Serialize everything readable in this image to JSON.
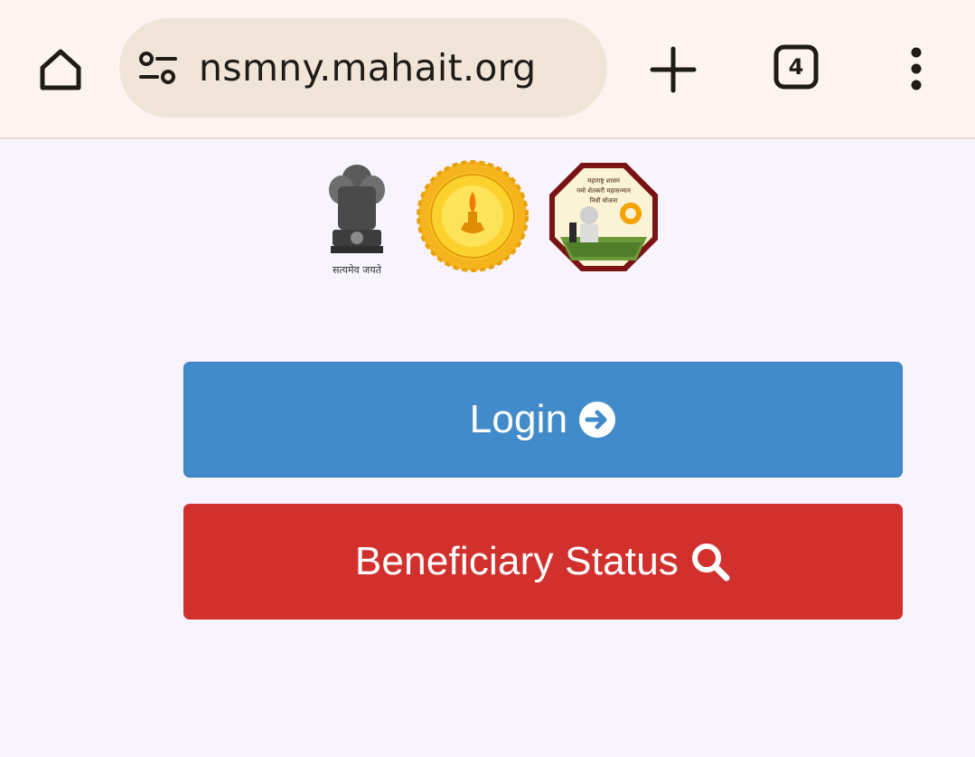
{
  "browser": {
    "url": "nsmny.mahait.org",
    "tab_count": "4",
    "icons": [
      "home-icon",
      "site-settings-icon",
      "new-tab-plus-icon",
      "tab-switcher-icon",
      "overflow-menu-icon"
    ]
  },
  "header": {
    "logos": [
      {
        "name": "ashoka-emblem",
        "caption": "सत्यमेव जयते"
      },
      {
        "name": "maharashtra-state-seal"
      },
      {
        "name": "namo-shetkari-mahasanman-nidhi-logo",
        "lines": [
          "महाराष्ट्र शासन",
          "नमो शेतकरी महासन्मान",
          "निधी योजना"
        ]
      }
    ]
  },
  "actions": {
    "login_label": "Login",
    "login_icon": "arrow-circle-right-icon",
    "status_label": "Beneficiary Status",
    "status_icon": "search-icon"
  },
  "colors": {
    "page_bg": "#f7f4fd",
    "toolbar_bg": "#fdf4f0",
    "url_pill_bg": "#f1e4d9",
    "login_button": "#428bca",
    "status_button": "#d2302d"
  }
}
